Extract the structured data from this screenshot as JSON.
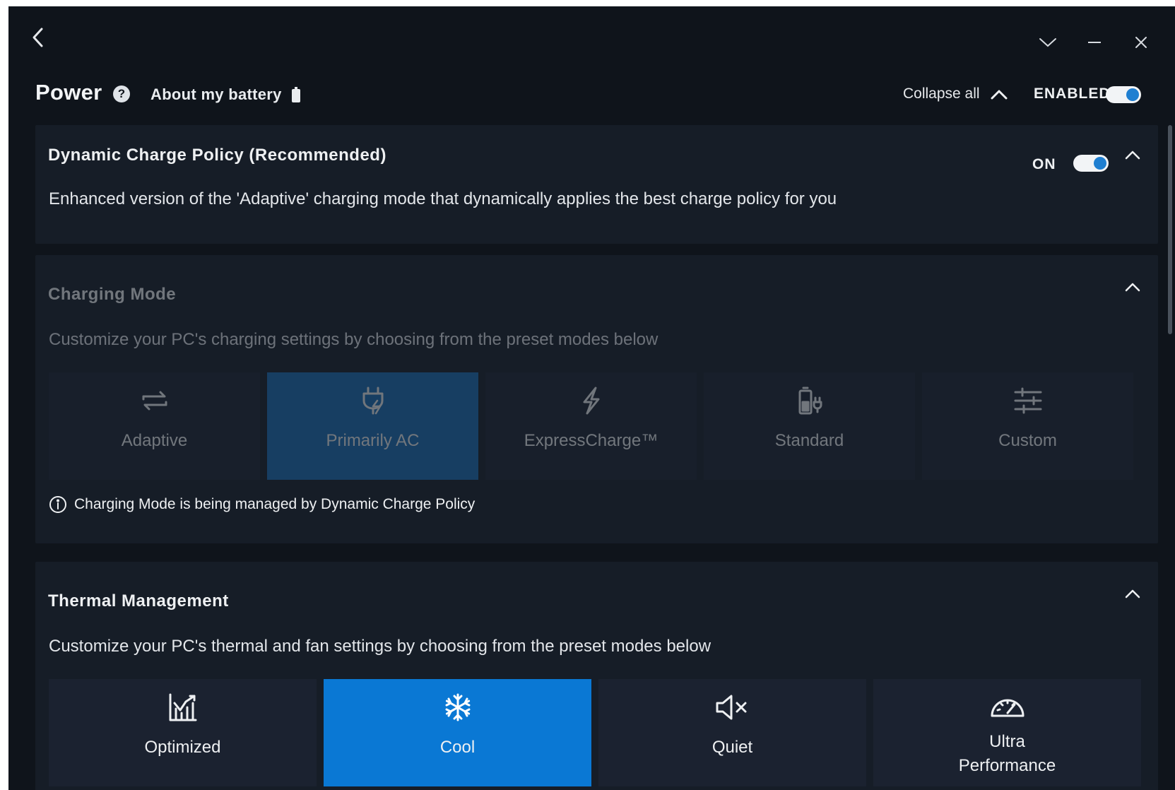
{
  "window": {
    "back_icon": "chevron-left-icon",
    "collapse_icon": "chevron-down-icon",
    "minimize_icon": "minimize-icon",
    "close_icon": "close-icon"
  },
  "header": {
    "title": "Power",
    "help_glyph": "?",
    "about_link": "About my battery",
    "collapse_all": "Collapse all",
    "enabled_label": "ENABLED",
    "enabled_state": true
  },
  "dynamic_charge_policy": {
    "title": "Dynamic Charge Policy (Recommended)",
    "on_label": "ON",
    "on_state": true,
    "description": "Enhanced version of the 'Adaptive' charging mode that dynamically applies the best charge policy for you"
  },
  "charging_mode": {
    "title": "Charging Mode",
    "description": "Customize your PC's charging settings by choosing from the preset modes below",
    "modes": [
      {
        "label": "Adaptive",
        "icon": "swap-arrows-icon",
        "selected": false
      },
      {
        "label": "Primarily AC",
        "icon": "plug-icon",
        "selected": true
      },
      {
        "label": "ExpressCharge™",
        "icon": "lightning-icon",
        "selected": false
      },
      {
        "label": "Standard",
        "icon": "battery-plug-icon",
        "selected": false
      },
      {
        "label": "Custom",
        "icon": "sliders-icon",
        "selected": false
      }
    ],
    "note": "Charging Mode is being managed by Dynamic Charge Policy"
  },
  "thermal_management": {
    "title": "Thermal Management",
    "description": "Customize your PC's thermal and fan settings by choosing from the preset modes below",
    "modes": [
      {
        "label": "Optimized",
        "icon": "chart-icon",
        "selected": false
      },
      {
        "label": "Cool",
        "icon": "snowflake-icon",
        "selected": true
      },
      {
        "label": "Quiet",
        "icon": "speaker-mute-icon",
        "selected": false
      },
      {
        "label": "Ultra Performance",
        "icon": "speedometer-icon",
        "selected": false
      }
    ]
  },
  "colors": {
    "background": "#0f141b",
    "card": "#161d27",
    "accent": "#0a78d4",
    "toggle_knob": "#1f7fd1"
  }
}
